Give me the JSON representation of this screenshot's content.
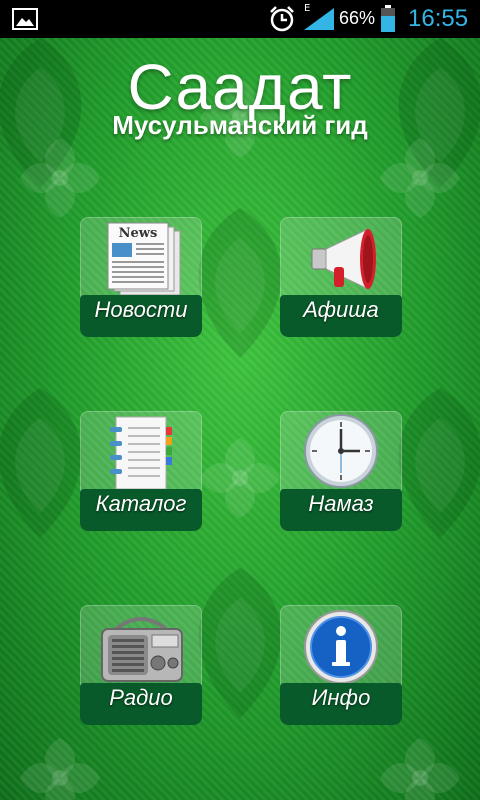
{
  "status_bar": {
    "network_type": "E",
    "battery_percent": "66%",
    "time": "16:55",
    "icons": [
      "image-icon",
      "alarm-clock-icon",
      "signal-icon",
      "battery-icon"
    ],
    "clock_color": "#33b5e5"
  },
  "header": {
    "title": "Саадат",
    "subtitle": "Мусульманский гид"
  },
  "menu": {
    "items": [
      {
        "label": "Новости",
        "icon": "newspaper-icon"
      },
      {
        "label": "Афиша",
        "icon": "megaphone-icon"
      },
      {
        "label": "Каталог",
        "icon": "notebook-icon"
      },
      {
        "label": "Намаз",
        "icon": "clock-icon"
      },
      {
        "label": "Радио",
        "icon": "radio-icon"
      },
      {
        "label": "Инфо",
        "icon": "info-icon"
      }
    ]
  },
  "colors": {
    "background": "#2aa636",
    "label_bar": "#085a2a",
    "text": "#ffffff"
  }
}
